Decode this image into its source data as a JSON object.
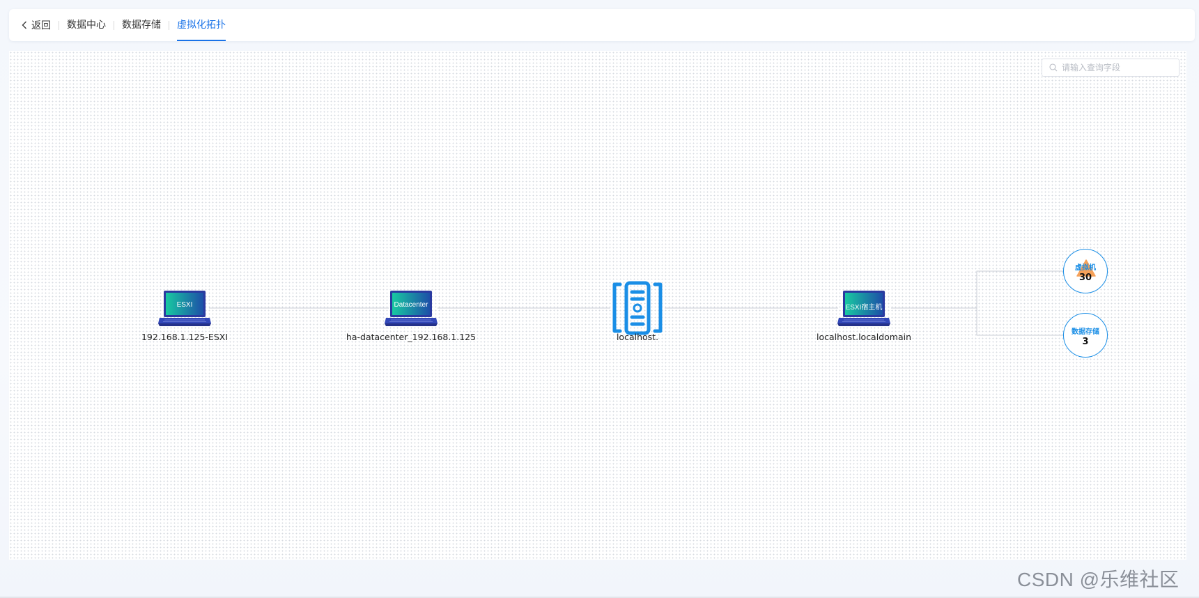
{
  "nav": {
    "back_label": "返回",
    "breadcrumbs": [
      {
        "label": "数据中心",
        "active": false
      },
      {
        "label": "数据存储",
        "active": false
      },
      {
        "label": "虚拟化拓扑",
        "active": true
      }
    ]
  },
  "search": {
    "placeholder": "请输入查询字段",
    "value": ""
  },
  "topology": {
    "nodes": [
      {
        "screen_text": "ESXI",
        "label": "192.168.1.125-ESXI",
        "icon": "laptop-icon"
      },
      {
        "screen_text": "Datacenter",
        "label": "ha-datacenter_192.168.1.125",
        "icon": "laptop-icon"
      },
      {
        "label": "localhost.",
        "icon": "server-icon"
      },
      {
        "screen_text": "ESXI宿主机",
        "label": "localhost.localdomain",
        "icon": "laptop-icon"
      }
    ],
    "leaves": [
      {
        "label": "虚拟机",
        "count": "30",
        "warning": true
      },
      {
        "label": "数据存储",
        "count": "3",
        "warning": false
      }
    ]
  },
  "colors": {
    "accent": "#1a73e8",
    "node_blue": "#1a8ee6",
    "warning": "#f5a15a",
    "edge": "#c9ced6"
  },
  "watermark": "CSDN @乐维社区"
}
